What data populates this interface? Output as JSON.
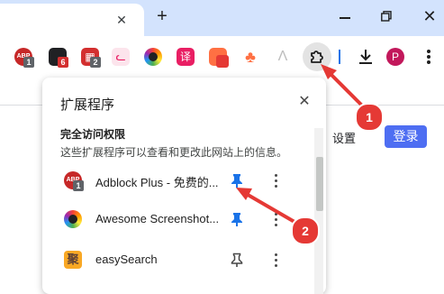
{
  "browser": {
    "tab_close": "✕",
    "new_tab": "+",
    "window_close": "✕",
    "profile_initial": "P"
  },
  "toolbar": {
    "extensions": [
      {
        "name": "adblock-plus",
        "color": "#c62828",
        "badge": "1",
        "badge_color": "#5f6368",
        "label": "ABP"
      },
      {
        "name": "ext-dark",
        "color": "#202124",
        "badge": "6",
        "badge_color": "#d32f2f",
        "label": ""
      },
      {
        "name": "ext-red",
        "color": "#d32f2f",
        "badge": "2",
        "badge_color": "#5f6368",
        "label": "▦"
      },
      {
        "name": "cat-face",
        "color": "#f8bbd0",
        "label": "ᓚ"
      },
      {
        "name": "awesome-screenshot",
        "color": "#7b1fa2",
        "label": ""
      },
      {
        "name": "translate",
        "color": "#e91e63",
        "label": "译"
      },
      {
        "name": "ext-orange",
        "color": "#ff7043",
        "label": ""
      },
      {
        "name": "ext-fire",
        "color": "#ff7043",
        "label": "♣"
      },
      {
        "name": "ext-gray",
        "color": "#bdbdbd",
        "label": "Λ"
      }
    ]
  },
  "page": {
    "settings": "设置",
    "login": "登录"
  },
  "popup": {
    "title": "扩展程序",
    "close": "✕",
    "section_title": "完全访问权限",
    "section_desc": "这些扩展程序可以查看和更改此网站上的信息。",
    "items": [
      {
        "name": "Adblock Plus - 免费的...",
        "pinned": true,
        "icon_color": "#c62828",
        "badge": "1"
      },
      {
        "name": "Awesome Screenshot...",
        "pinned": true,
        "icon_color": "#7b1fa2"
      },
      {
        "name": "easySearch",
        "pinned": false,
        "icon_color": "#f9a825",
        "icon_label": "聚"
      }
    ]
  },
  "annotations": {
    "callout_1": "1",
    "callout_2": "2",
    "color": "#e53935"
  }
}
